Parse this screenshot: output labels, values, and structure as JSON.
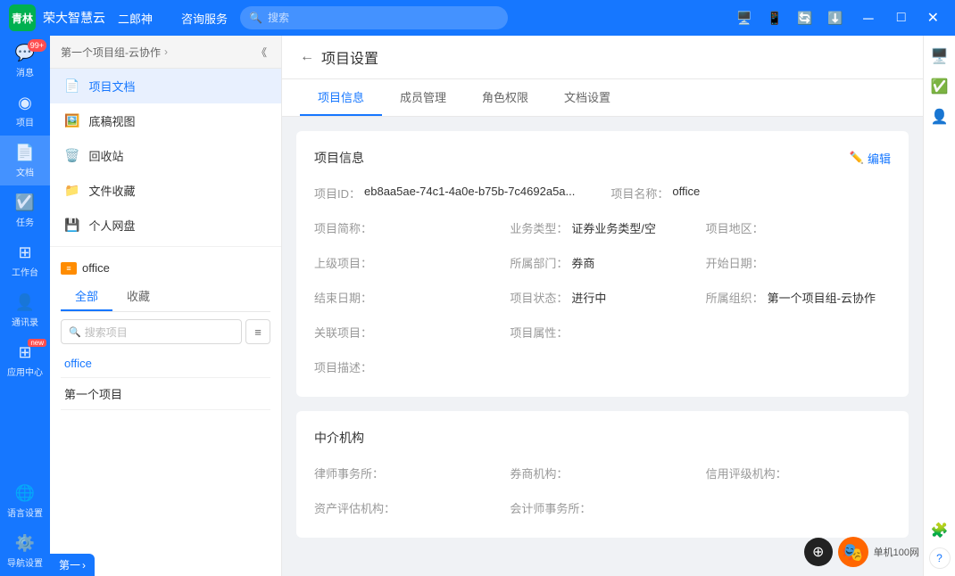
{
  "app": {
    "logo": "青林",
    "title": "荣大智慧云",
    "nav": [
      "二郎神",
      "咨询服务"
    ],
    "search_placeholder": "搜索"
  },
  "topbar_icons": [
    "🖥️",
    "📱",
    "🔄",
    "⬇️"
  ],
  "win_controls": [
    "－",
    "□",
    "✕"
  ],
  "sidebar": {
    "breadcrumb_part1": "第一个项目组-云协作",
    "collapse_icon": "《",
    "menu_items": [
      {
        "icon": "📄",
        "label": "项目文档",
        "active": true
      },
      {
        "icon": "🖼️",
        "label": "底稿视图"
      },
      {
        "icon": "🗑️",
        "label": "回收站"
      },
      {
        "icon": "📁",
        "label": "文件收藏"
      },
      {
        "icon": "💾",
        "label": "个人网盘"
      }
    ],
    "project_label": "office",
    "tabs": [
      "全部",
      "收藏"
    ],
    "search_placeholder": "搜索项目",
    "projects": [
      {
        "name": "office",
        "highlight": true
      },
      {
        "name": "第一个项目",
        "highlight": false
      }
    ]
  },
  "icon_nav": [
    {
      "icon": "99+",
      "label": "消息",
      "badge": "99+"
    },
    {
      "icon": "◉",
      "label": "项目"
    },
    {
      "icon": "📄",
      "label": "文档",
      "active": true
    },
    {
      "icon": "☑️",
      "label": "任务"
    },
    {
      "icon": "⊞",
      "label": "工作台"
    },
    {
      "icon": "👤",
      "label": "通讯录"
    },
    {
      "icon": "⊞",
      "label": "应用中心",
      "new_badge": "new"
    },
    {
      "icon": "🌐",
      "label": "语言设置"
    },
    {
      "icon": "⚙️",
      "label": "导航设置"
    }
  ],
  "right_sidebar": [
    {
      "icon": "🖥️",
      "color": "blue"
    },
    {
      "icon": "✅",
      "color": "blue"
    },
    {
      "icon": "👤",
      "color": "orange"
    },
    {
      "icon": "🧩",
      "color": "default"
    },
    {
      "icon": "❓",
      "color": "default"
    }
  ],
  "page": {
    "back_label": "←",
    "title": "项目设置",
    "tabs": [
      "项目信息",
      "成员管理",
      "角色权限",
      "文档设置"
    ],
    "active_tab": 0
  },
  "project_info": {
    "section_title": "项目信息",
    "edit_label": "编辑",
    "fields": [
      {
        "label": "项目ID：",
        "value": "eb8aa5ae-74c1-4a0e-b75b-7c4692a5a..."
      },
      {
        "label": "项目名称：",
        "value": "office"
      },
      {
        "label": "项目简称：",
        "value": ""
      },
      {
        "label": "业务类型：",
        "value": "证券业务类型/空"
      },
      {
        "label": "项目地区：",
        "value": ""
      },
      {
        "label": "上级项目：",
        "value": ""
      },
      {
        "label": "所属部门：",
        "value": "券商"
      },
      {
        "label": "开始日期：",
        "value": ""
      },
      {
        "label": "结束日期：",
        "value": ""
      },
      {
        "label": "项目状态：",
        "value": "进行中"
      },
      {
        "label": "所属组织：",
        "value": "第一个项目组-云协作"
      },
      {
        "label": "关联项目：",
        "value": ""
      },
      {
        "label": "项目属性：",
        "value": ""
      },
      {
        "label": "项目描述：",
        "value": ""
      }
    ]
  },
  "intermediary": {
    "section_title": "中介机构",
    "fields": [
      {
        "label": "律师事务所：",
        "value": ""
      },
      {
        "label": "券商机构：",
        "value": ""
      },
      {
        "label": "信用评级机构：",
        "value": ""
      },
      {
        "label": "资产评估机构：",
        "value": ""
      },
      {
        "label": "会计师事务所：",
        "value": ""
      }
    ]
  },
  "bottom_tab": "第一",
  "watermark": "单机100网"
}
